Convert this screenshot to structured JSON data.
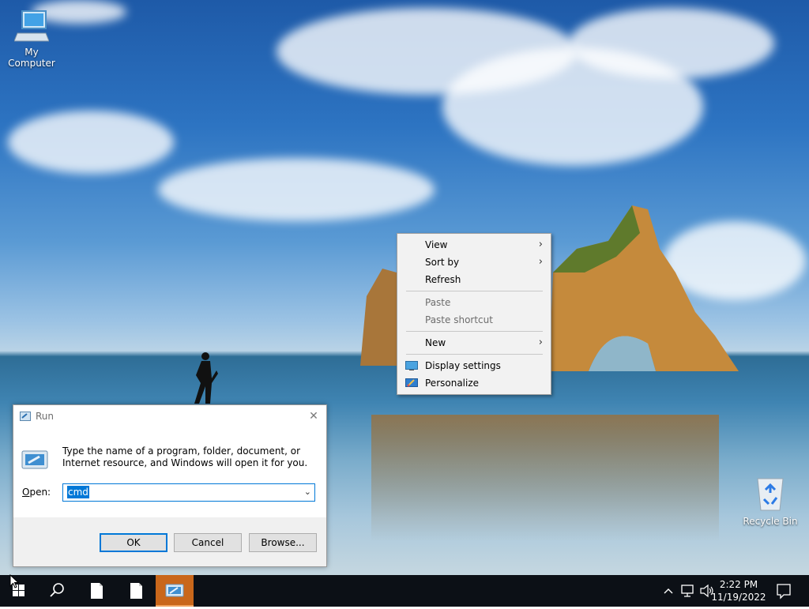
{
  "desktop": {
    "icons": [
      {
        "label": "My Computer",
        "icon": "computer-icon"
      },
      {
        "label": "Recycle Bin",
        "icon": "recycle-bin-icon"
      }
    ]
  },
  "context_menu": {
    "items": [
      {
        "label": "View",
        "submenu": true
      },
      {
        "label": "Sort by",
        "submenu": true
      },
      {
        "label": "Refresh"
      },
      {
        "label": "Paste",
        "disabled": true
      },
      {
        "label": "Paste shortcut",
        "disabled": true
      },
      {
        "label": "New",
        "submenu": true
      },
      {
        "label": "Display settings",
        "icon": "display-icon"
      },
      {
        "label": "Personalize",
        "icon": "personalize-icon"
      }
    ]
  },
  "run_dialog": {
    "title": "Run",
    "description": "Type the name of a program, folder, document, or Internet resource, and Windows will open it for you.",
    "open_label_prefix": "O",
    "open_label_rest": "pen:",
    "input_value": "cmd",
    "ok_label": "OK",
    "cancel_label": "Cancel",
    "browse_label": "Browse..."
  },
  "taskbar": {
    "time": "2:22 PM",
    "date": "11/19/2022"
  },
  "colors": {
    "accent": "#0078d7",
    "taskbar": "#0c1016",
    "active_taskbar_button": "#c9671b"
  }
}
